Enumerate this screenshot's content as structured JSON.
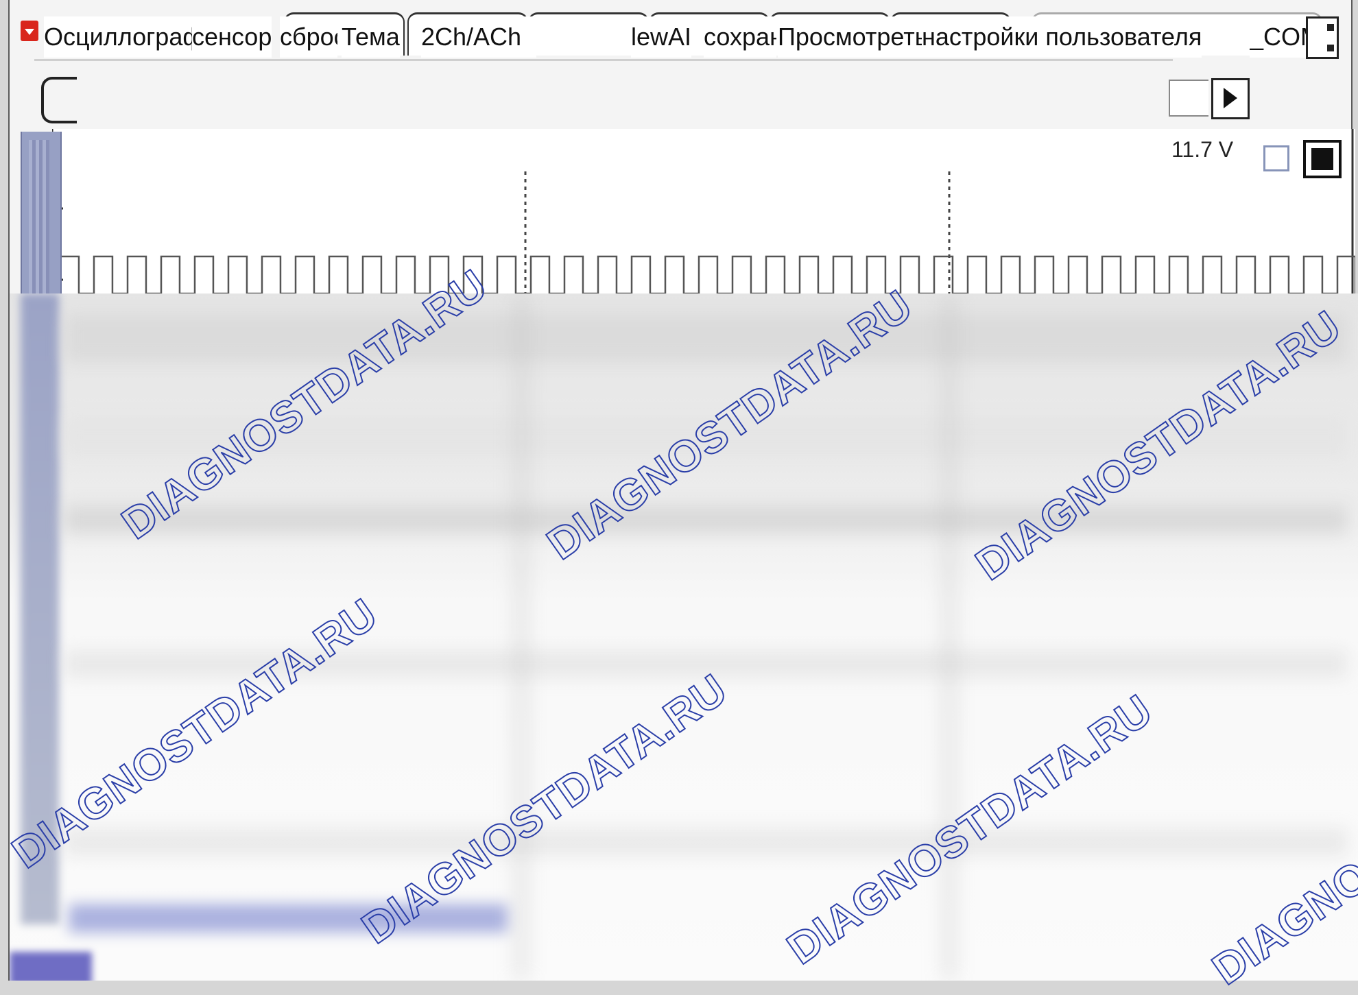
{
  "menu": {
    "items": [
      "Осциллограф",
      "сенсор",
      "сброс зв",
      "Тема",
      "2Ch/ACh",
      "lewAI",
      "сохран",
      "Просмотреть",
      "настройки пользователя",
      "_COM"
    ]
  },
  "readout": {
    "voltage": "11.7 V"
  },
  "watermark": {
    "text": "DIAGNOSTDATA.RU"
  },
  "colors": {
    "window_bg": "#f4f4f4",
    "accent_icon": "#d9261c",
    "watermark": "#2a3ea8",
    "sidebar": "#97a0c4",
    "trace": "#555555"
  },
  "icons": {
    "app": "red-dropdown-icon",
    "play": "play-icon",
    "close": "close-icon"
  }
}
